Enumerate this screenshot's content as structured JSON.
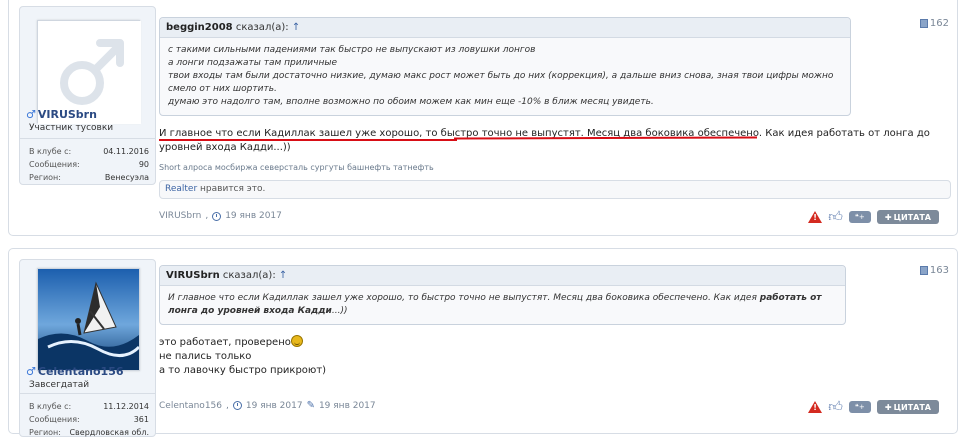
{
  "posts": [
    {
      "number": "162",
      "user": {
        "name": "VIRUSbrn",
        "title": "Участник тусовки",
        "joined_label": "В клубе с:",
        "joined": "04.11.2016",
        "posts_label": "Сообщения:",
        "posts": "90",
        "region_label": "Регион:",
        "region": "Венесуэла"
      },
      "quote": {
        "author": "beggin2008",
        "said": "сказал(а):",
        "arrow": "↑",
        "lines": [
          "с такими сильными падениями так быстро не выпускают из ловушки лонгов",
          "а лонги подзажаты там приличные",
          "твои входы там были достаточно низкие, думаю макс рост может быть до них (коррекция), а дальше вниз снова, зная твои цифры можно",
          "смело от них шортить.",
          "думаю это надолго там, вполне возможно по обоим можем как мин еще -10% в ближ месяц увидеть."
        ]
      },
      "message": {
        "line1": "И главное что если Кадиллак зашел уже хорошо, то быстро точно не выпустят. Месяц два боковика обеспечено. Как идея работать от лонга до",
        "line2": "уровней входа Кадди...))"
      },
      "signature": "Short алроса мосбиржа северсталь сургуты башнефть татнефть",
      "likes": {
        "user": "Realter",
        "text": "нравится это."
      },
      "meta": {
        "author": "VIRUSbrn",
        "date": "19 янв 2017"
      },
      "quote_button": "ЦИТАТА"
    },
    {
      "number": "163",
      "user": {
        "name": "Celentano156",
        "title": "Завсегдатай",
        "joined_label": "В клубе с:",
        "joined": "11.12.2014",
        "posts_label": "Сообщения:",
        "posts": "361",
        "region_label": "Регион:",
        "region": "Свердловская обл."
      },
      "quote": {
        "author": "VIRUSbrn",
        "said": "сказал(а):",
        "arrow": "↑",
        "line1_normal": "И главное что если Кадиллак зашел уже хорошо, то быстро точно не выпустят. Месяц два боковика обеспечено. Как идея ",
        "line1_bold": "работать от",
        "line2_bold": "лонга до уровней входа Кадди",
        "line2_normal": "...))"
      },
      "message": {
        "line1": "это работает, проверено",
        "line2": "не пались только",
        "line3": "а то лавочку быстро прикроют)"
      },
      "meta": {
        "author": "Celentano156",
        "date": "19 янв 2017",
        "edited": "19 янв 2017"
      },
      "quote_button": "ЦИТАТА"
    }
  ],
  "colors": {
    "accent": "#3c64a4",
    "underline": "#d80e16",
    "warn": "#d42a20"
  }
}
